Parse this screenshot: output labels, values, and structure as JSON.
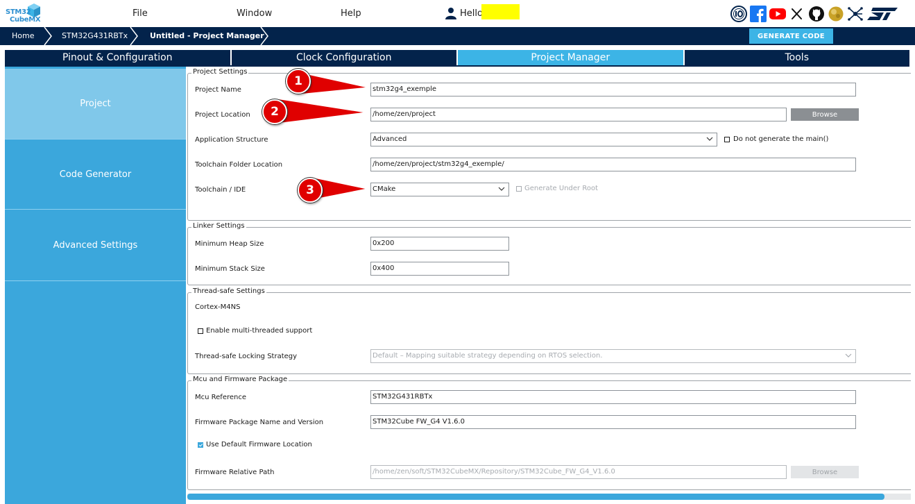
{
  "app": {
    "logo_top": "STM32",
    "logo_bottom": "CubeMX"
  },
  "menu": {
    "file": "File",
    "window": "Window",
    "help": "Help",
    "hello": "Hello"
  },
  "breadcrumb": {
    "home": "Home",
    "device": "STM32G431RBTx",
    "project": "Untitled - Project Manager"
  },
  "toolbar": {
    "generate_code": "GENERATE CODE"
  },
  "tabs": [
    {
      "label": "Pinout & Configuration"
    },
    {
      "label": "Clock Configuration"
    },
    {
      "label": "Project Manager"
    },
    {
      "label": "Tools"
    }
  ],
  "sidebar": {
    "items": [
      {
        "label": "Project"
      },
      {
        "label": "Code Generator"
      },
      {
        "label": "Advanced Settings"
      }
    ]
  },
  "project_settings": {
    "legend": "Project Settings",
    "name_label": "Project Name",
    "name_value": "stm32g4_exemple",
    "location_label": "Project Location",
    "location_value": "/home/zen/project",
    "browse": "Browse",
    "app_structure_label": "Application Structure",
    "app_structure_value": "Advanced",
    "no_main_label": "Do not generate the main()",
    "toolchain_folder_label": "Toolchain Folder Location",
    "toolchain_folder_value": "/home/zen/project/stm32g4_exemple/",
    "toolchain_label": "Toolchain / IDE",
    "toolchain_value": "CMake",
    "under_root_label": "Generate Under Root"
  },
  "linker_settings": {
    "legend": "Linker Settings",
    "heap_label": "Minimum Heap Size",
    "heap_value": "0x200",
    "stack_label": "Minimum Stack Size",
    "stack_value": "0x400"
  },
  "thread_safe": {
    "legend": "Thread-safe Settings",
    "core": "Cortex-M4NS",
    "multi_thread_label": "Enable multi-threaded support",
    "strategy_label": "Thread-safe Locking Strategy",
    "strategy_value": "Default – Mapping suitable strategy depending on RTOS selection."
  },
  "mcu_firmware": {
    "legend": "Mcu and Firmware Package",
    "mcu_label": "Mcu Reference",
    "mcu_value": "STM32G431RBTx",
    "fw_label": "Firmware Package Name and Version",
    "fw_value": "STM32Cube FW_G4 V1.6.0",
    "default_loc_label": "Use Default Firmware Location",
    "rel_path_label": "Firmware Relative Path",
    "rel_path_value": "/home/zen/soft/STM32CubeMX/Repository/STM32Cube_FW_G4_V1.6.0",
    "browse": "Browse"
  },
  "callouts": [
    "1",
    "2",
    "3"
  ],
  "colors": {
    "navy": "#03234b",
    "accent": "#3cb4e6",
    "sidebar": "#3ba7dc",
    "sidebar_active": "#80c8ea",
    "callout": "#e00000"
  }
}
